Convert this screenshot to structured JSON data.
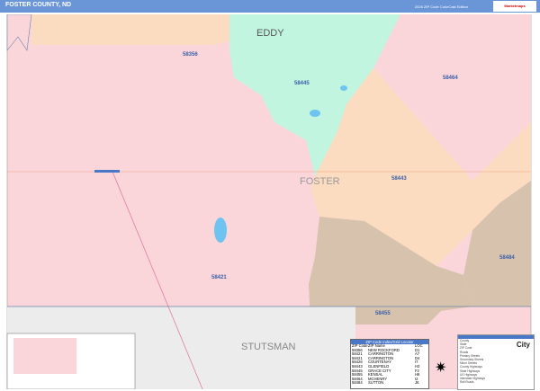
{
  "header": {
    "title": "FOSTER COUNTY, ND",
    "edition": "2026 ZIP Code ColorCast Edition",
    "logo": "Marketmaps"
  },
  "map": {
    "county_labels": [
      "EDDY",
      "FOSTER",
      "STUTSMAN"
    ],
    "zip_labels": [
      "58356",
      "58445",
      "58464",
      "58443",
      "58484",
      "58421",
      "58455"
    ],
    "colors": {
      "pink": "#fad6da",
      "peach": "#fcdcc0",
      "mint": "#c2f5e0",
      "tan": "#d7c3ad",
      "gray": "#ececec",
      "water": "#6fc3f0",
      "boundary": "#6b84a8"
    }
  },
  "zip_table": {
    "title": "ZIP Code Index/Grid Locator",
    "headers": [
      "ZIP Code",
      "ZIP Name",
      "LOC"
    ],
    "rows": [
      [
        "58356",
        "NEW ROCKFORD",
        "D1"
      ],
      [
        "58421",
        "CARRINGTON",
        "A7"
      ],
      [
        "58421",
        "CARRINGTON",
        "D4"
      ],
      [
        "58426",
        "COURTENAY",
        "I7"
      ],
      [
        "58443",
        "GLENFIELD",
        "H3"
      ],
      [
        "58445",
        "GRACE CITY",
        "F2"
      ],
      [
        "58455",
        "KENSAL",
        "H6"
      ],
      [
        "58464",
        "MCHENRY",
        "I2"
      ],
      [
        "58484",
        "SUTTON",
        "J6"
      ]
    ]
  },
  "legend": {
    "items": [
      "County",
      "State",
      "ZIP Code",
      "Roads",
      "Primary Streets",
      "Secondary Streets",
      "Minor Streets",
      "County Highways",
      "State Highways",
      "US Highways",
      "Interstate Highways",
      "Rail Roads"
    ],
    "city_label": "City"
  }
}
